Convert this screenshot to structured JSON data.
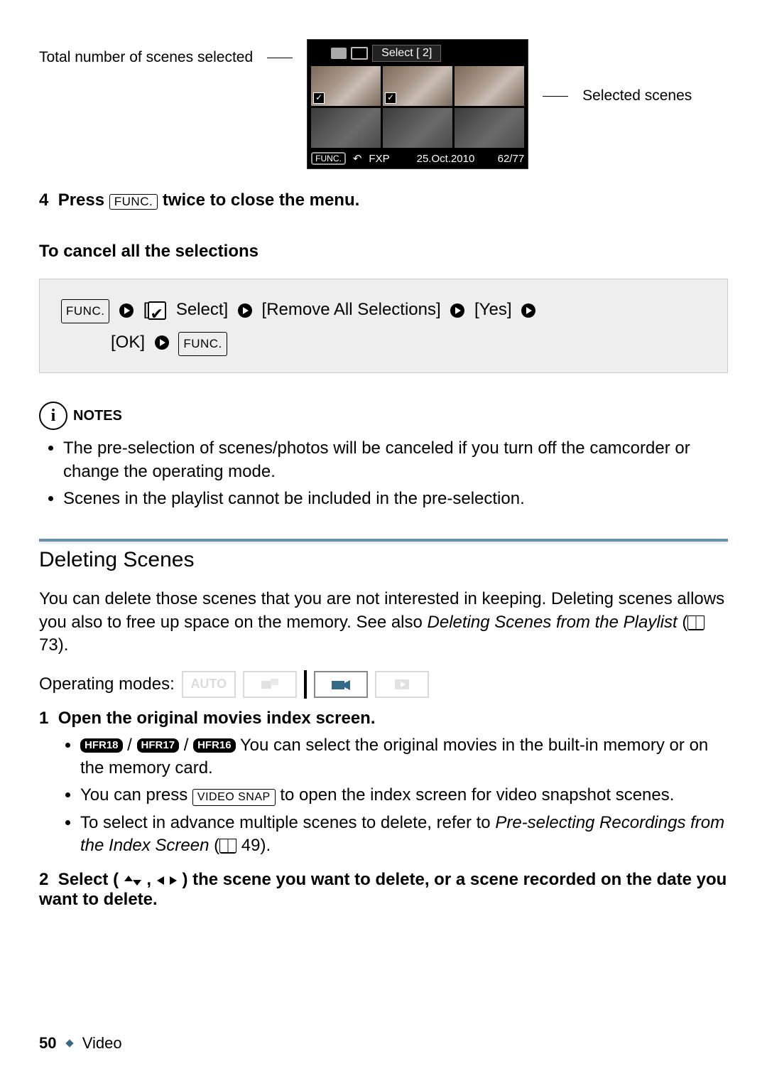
{
  "calloutLeft": "Total number of scenes selected",
  "calloutRight": "Selected scenes",
  "screenshot": {
    "title": "Select [  2]",
    "bottom": {
      "func": "FUNC.",
      "fxp": "FXP",
      "date": "25.Oct.2010",
      "count": "62/77"
    }
  },
  "step4": {
    "num": "4",
    "lead": "Press",
    "btn": "FUNC.",
    "rest": "twice to close the menu."
  },
  "cancel": {
    "heading": "To cancel all the selections",
    "func": "FUNC.",
    "select": "Select]",
    "remove": "[Remove All Selections]",
    "yes": "[Yes]",
    "ok": "[OK]"
  },
  "notesHead": "NOTES",
  "notes": [
    "The pre-selection of scenes/photos will be canceled if you turn off the camcorder or change the operating mode.",
    "Scenes in the playlist cannot be included in the pre-selection."
  ],
  "sectionTitle": "Deleting Scenes",
  "sectionBody": {
    "p1": "You can delete those scenes that you are not interested in keeping. Deleting scenes allows you also to free up space on the memory. See also ",
    "ital": "Deleting Scenes from the Playlist",
    "pref": " 73)."
  },
  "operating": "Operating modes:",
  "autoText": "AUTO",
  "steps": {
    "s1": {
      "num": "1",
      "head": "Open the original movies index screen.",
      "models": [
        "HFR18",
        "HFR17",
        "HFR16"
      ],
      "b1rest": " You can select the original movies in the built-in memory or on the memory card.",
      "b2a": "You can press ",
      "b2btn": "VIDEO SNAP",
      "b2b": " to open the index screen for video snapshot scenes.",
      "b3a": "To select in advance multiple scenes to delete, refer to ",
      "b3ital": "Pre-selecting Recordings from the Index Screen",
      "b3pref": " 49)."
    },
    "s2": {
      "num": "2",
      "head_a": "Select (",
      "head_b": ") the scene you want to delete, or a scene recorded on the date you want to delete."
    }
  },
  "footer": {
    "page": "50",
    "section": "Video"
  }
}
